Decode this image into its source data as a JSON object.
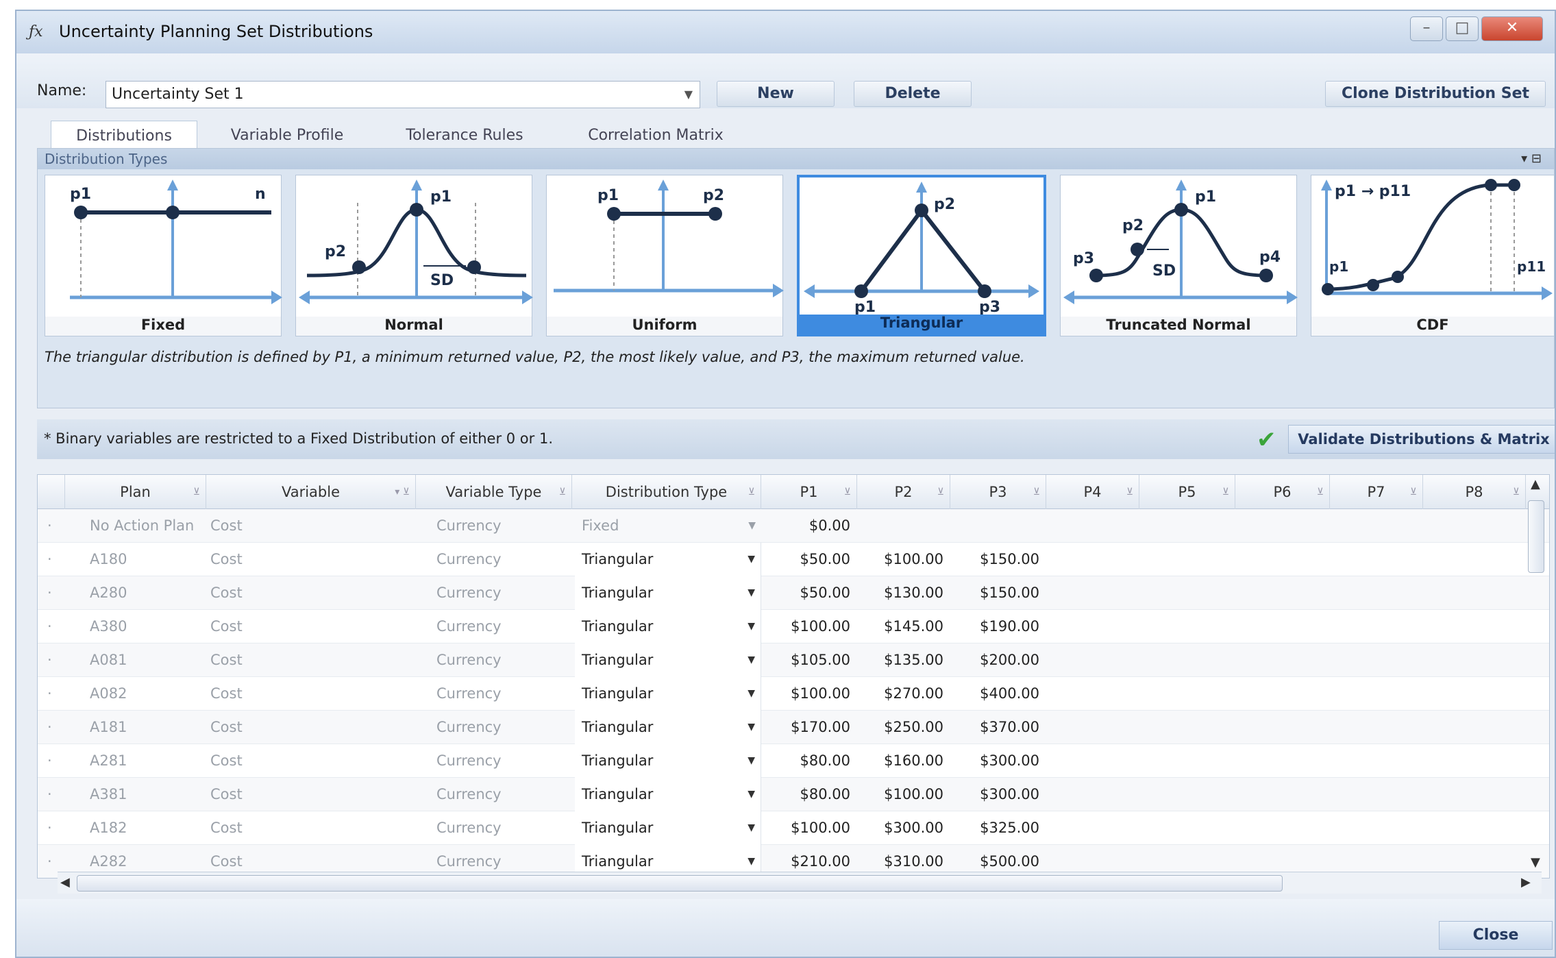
{
  "window": {
    "title": "Uncertainty Planning Set Distributions",
    "icon": "fx-icon"
  },
  "toolbar": {
    "name_label": "Name:",
    "name_value": "Uncertainty Set 1",
    "new_label": "New",
    "delete_label": "Delete",
    "clone_label": "Clone Distribution Set"
  },
  "tabs": [
    {
      "label": "Distributions",
      "active": true
    },
    {
      "label": "Variable Profile"
    },
    {
      "label": "Tolerance Rules"
    },
    {
      "label": "Correlation Matrix"
    }
  ],
  "dist_panel": {
    "header": "Distribution Types",
    "types": [
      "Fixed",
      "Normal",
      "Uniform",
      "Triangular",
      "Truncated Normal",
      "CDF"
    ],
    "selected": "Triangular",
    "description": "The triangular distribution is defined by P1, a minimum returned value, P2, the most likely value, and P3, the maximum returned value."
  },
  "note": "* Binary variables are restricted to a Fixed Distribution of either 0 or 1.",
  "validate_label": "Validate Distributions & Matrix",
  "columns": [
    "Plan",
    "Variable",
    "Variable Type",
    "Distribution Type",
    "P1",
    "P2",
    "P3",
    "P4",
    "P5",
    "P6",
    "P7",
    "P8"
  ],
  "rows": [
    {
      "plan": "No Action Plan",
      "variable": "Cost",
      "type": "Currency",
      "dist": "Fixed",
      "p1": "$0.00",
      "p2": "",
      "p3": ""
    },
    {
      "plan": "A180",
      "variable": "Cost",
      "type": "Currency",
      "dist": "Triangular",
      "p1": "$50.00",
      "p2": "$100.00",
      "p3": "$150.00"
    },
    {
      "plan": "A280",
      "variable": "Cost",
      "type": "Currency",
      "dist": "Triangular",
      "p1": "$50.00",
      "p2": "$130.00",
      "p3": "$150.00"
    },
    {
      "plan": "A380",
      "variable": "Cost",
      "type": "Currency",
      "dist": "Triangular",
      "p1": "$100.00",
      "p2": "$145.00",
      "p3": "$190.00"
    },
    {
      "plan": "A081",
      "variable": "Cost",
      "type": "Currency",
      "dist": "Triangular",
      "p1": "$105.00",
      "p2": "$135.00",
      "p3": "$200.00"
    },
    {
      "plan": "A082",
      "variable": "Cost",
      "type": "Currency",
      "dist": "Triangular",
      "p1": "$100.00",
      "p2": "$270.00",
      "p3": "$400.00"
    },
    {
      "plan": "A181",
      "variable": "Cost",
      "type": "Currency",
      "dist": "Triangular",
      "p1": "$170.00",
      "p2": "$250.00",
      "p3": "$370.00"
    },
    {
      "plan": "A281",
      "variable": "Cost",
      "type": "Currency",
      "dist": "Triangular",
      "p1": "$80.00",
      "p2": "$160.00",
      "p3": "$300.00"
    },
    {
      "plan": "A381",
      "variable": "Cost",
      "type": "Currency",
      "dist": "Triangular",
      "p1": "$80.00",
      "p2": "$100.00",
      "p3": "$300.00"
    },
    {
      "plan": "A182",
      "variable": "Cost",
      "type": "Currency",
      "dist": "Triangular",
      "p1": "$100.00",
      "p2": "$300.00",
      "p3": "$325.00"
    },
    {
      "plan": "A282",
      "variable": "Cost",
      "type": "Currency",
      "dist": "Triangular",
      "p1": "$210.00",
      "p2": "$310.00",
      "p3": "$500.00"
    }
  ],
  "footer": {
    "close_label": "Close"
  }
}
